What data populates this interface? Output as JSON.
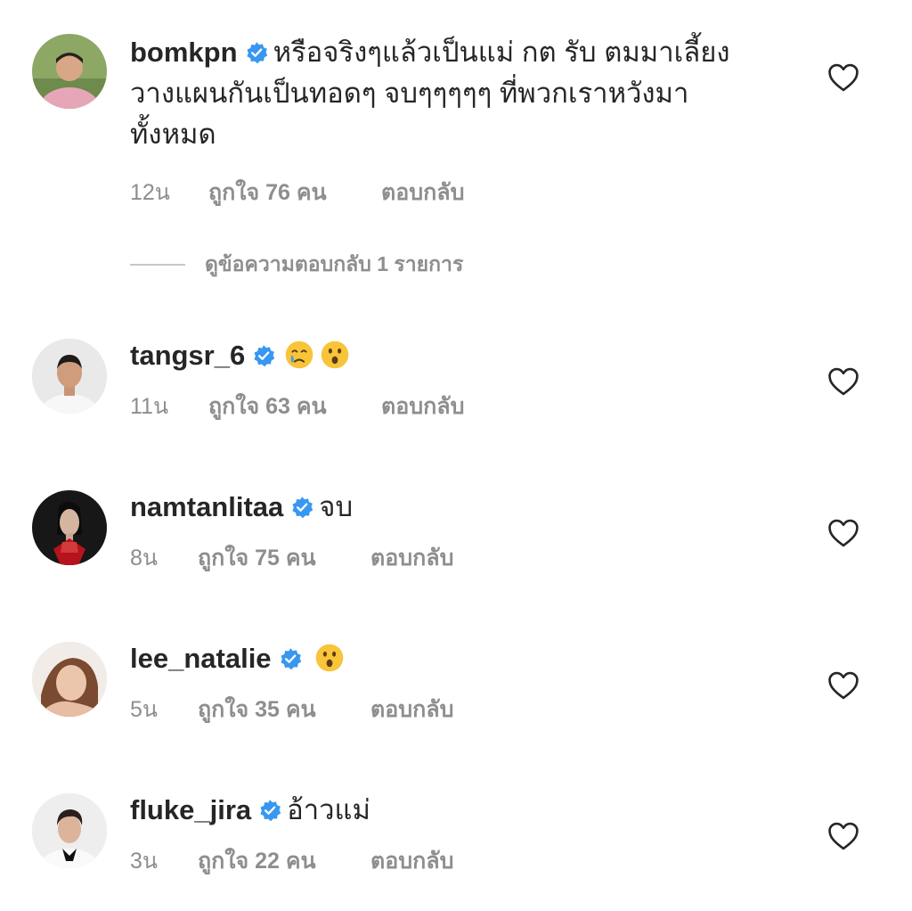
{
  "comments": [
    {
      "username": "bomkpn",
      "text_lines": [
        "หรือจริงๆแล้วเป็นแม่ กต รับ ตมมาเลี้ยง",
        "วางแผนกันเป็นทอดๆ  จบๆๆๆๆๆ ที่พวกเราหวังมา",
        "ทั้งหมด"
      ],
      "time": "12น",
      "likes": "ถูกใจ 76 คน",
      "reply": "ตอบกลับ",
      "verified": true,
      "avatar": "man-pink-shirt"
    },
    {
      "username": "tangsr_6",
      "text": "",
      "emojis": [
        "crying-face-icon",
        "surprised-face-icon"
      ],
      "time": "11น",
      "likes": "ถูกใจ 63 คน",
      "reply": "ตอบกลับ",
      "verified": true,
      "avatar": "man-white-tee"
    },
    {
      "username": "namtanlitaa",
      "text": "จบ",
      "time": "8น",
      "likes": "ถูกใจ 75 คน",
      "reply": "ตอบกลับ",
      "verified": true,
      "avatar": "woman-dark-background"
    },
    {
      "username": "lee_natalie",
      "text": "",
      "emojis": [
        "surprised-face-icon"
      ],
      "time": "5น",
      "likes": "ถูกใจ 35 คน",
      "reply": "ตอบกลับ",
      "verified": true,
      "avatar": "woman-light-background"
    },
    {
      "username": "fluke_jira",
      "text": "อ้าวแม่",
      "time": "3น",
      "likes": "ถูกใจ 22 คน",
      "reply": "ตอบกลับ",
      "verified": true,
      "avatar": "man-tuxedo"
    }
  ],
  "view_replies": "ดูข้อความตอบกลับ 1 รายการ",
  "colors": {
    "text": "#262626",
    "meta": "#8e8e8e",
    "verified": "#3897f0",
    "heart": "#262626"
  }
}
